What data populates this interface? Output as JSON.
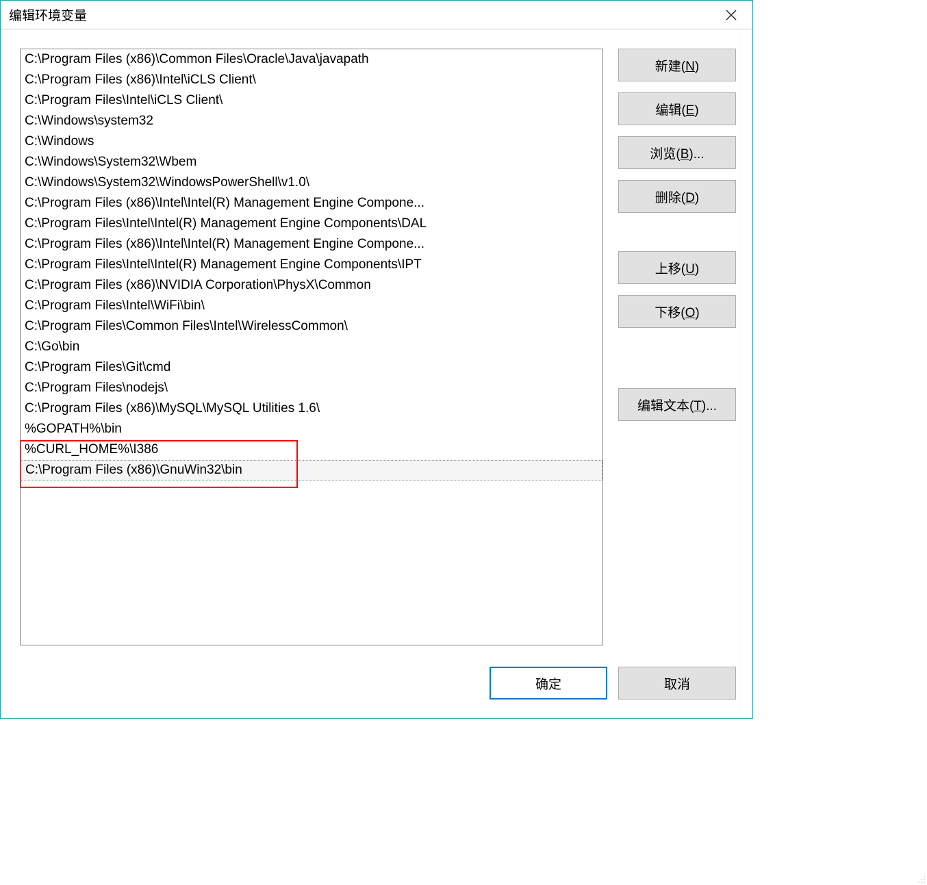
{
  "title": "编辑环境变量",
  "paths": [
    "C:\\Program Files (x86)\\Common Files\\Oracle\\Java\\javapath",
    "C:\\Program Files (x86)\\Intel\\iCLS Client\\",
    "C:\\Program Files\\Intel\\iCLS Client\\",
    "C:\\Windows\\system32",
    "C:\\Windows",
    "C:\\Windows\\System32\\Wbem",
    "C:\\Windows\\System32\\WindowsPowerShell\\v1.0\\",
    "C:\\Program Files (x86)\\Intel\\Intel(R) Management Engine Compone...",
    "C:\\Program Files\\Intel\\Intel(R) Management Engine Components\\DAL",
    "C:\\Program Files (x86)\\Intel\\Intel(R) Management Engine Compone...",
    "C:\\Program Files\\Intel\\Intel(R) Management Engine Components\\IPT",
    "C:\\Program Files (x86)\\NVIDIA Corporation\\PhysX\\Common",
    "C:\\Program Files\\Intel\\WiFi\\bin\\",
    "C:\\Program Files\\Common Files\\Intel\\WirelessCommon\\",
    "C:\\Go\\bin",
    "C:\\Program Files\\Git\\cmd",
    "C:\\Program Files\\nodejs\\",
    "C:\\Program Files (x86)\\MySQL\\MySQL Utilities 1.6\\",
    "%GOPATH%\\bin",
    "%CURL_HOME%\\I386",
    "C:\\Program Files (x86)\\GnuWin32\\bin"
  ],
  "selected_index": 20,
  "buttons": {
    "new": {
      "label": "新建(",
      "accel": "N",
      "tail": ")"
    },
    "edit": {
      "label": "编辑(",
      "accel": "E",
      "tail": ")"
    },
    "browse": {
      "label": "浏览(",
      "accel": "B",
      "tail": ")..."
    },
    "delete": {
      "label": "删除(",
      "accel": "D",
      "tail": ")"
    },
    "moveup": {
      "label": "上移(",
      "accel": "U",
      "tail": ")"
    },
    "movedown": {
      "label": "下移(",
      "accel": "O",
      "tail": ")"
    },
    "edittext": {
      "label": "编辑文本(",
      "accel": "T",
      "tail": ")..."
    },
    "ok": "确定",
    "cancel": "取消"
  }
}
